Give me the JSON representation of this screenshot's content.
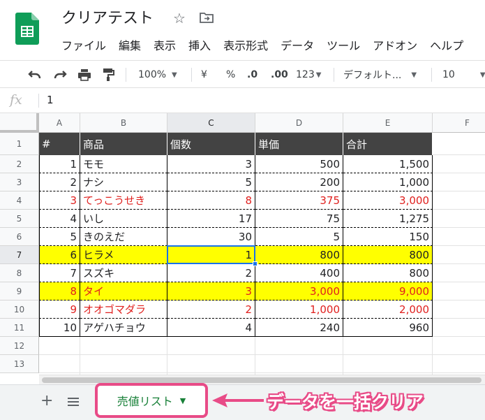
{
  "document": {
    "title": "クリアテスト"
  },
  "menu": [
    "ファイル",
    "編集",
    "表示",
    "挿入",
    "表示形式",
    "データ",
    "ツール",
    "アドオン",
    "ヘルプ"
  ],
  "toolbar": {
    "zoom": "100%",
    "currency": "¥",
    "percent": "%",
    "decrease_decimal": ".0",
    "increase_decimal": ".00",
    "number_format": "123",
    "font": "デフォルト...",
    "font_size": "10"
  },
  "formula_bar": {
    "fx": "fx",
    "value": "1"
  },
  "columns": [
    "A",
    "B",
    "C",
    "D",
    "E",
    "F"
  ],
  "rows": [
    "1",
    "2",
    "3",
    "4",
    "5",
    "6",
    "7",
    "8",
    "9",
    "10",
    "11",
    "12",
    "13"
  ],
  "table": {
    "headers": [
      "#",
      "商品",
      "個数",
      "単価",
      "合計"
    ],
    "data": [
      [
        "1",
        "モモ",
        "3",
        "500",
        "1,500"
      ],
      [
        "2",
        "ナシ",
        "5",
        "200",
        "1,000"
      ],
      [
        "3",
        "てっこうせき",
        "8",
        "375",
        "3,000"
      ],
      [
        "4",
        "いし",
        "17",
        "75",
        "1,275"
      ],
      [
        "5",
        "きのえだ",
        "30",
        "5",
        "150"
      ],
      [
        "6",
        "ヒラメ",
        "1",
        "800",
        "800"
      ],
      [
        "7",
        "スズキ",
        "2",
        "400",
        "800"
      ],
      [
        "8",
        "タイ",
        "3",
        "3,000",
        "9,000"
      ],
      [
        "9",
        "オオゴマダラ",
        "2",
        "1,000",
        "2,000"
      ],
      [
        "10",
        "アゲハチョウ",
        "4",
        "240",
        "960"
      ]
    ],
    "row_styles": [
      "normal",
      "normal",
      "red",
      "normal",
      "normal",
      "yellow",
      "normal",
      "yellow-red",
      "red",
      "normal"
    ]
  },
  "colors": {
    "header_bg": "#434343",
    "highlight_yellow": "#ffff00",
    "text_red": "#e0201e",
    "selection": "#1a73e8",
    "accent_pink": "#e84b87",
    "sheet_green": "#188038"
  },
  "sheet_tab": {
    "label": "売値リスト"
  },
  "annotation": {
    "text": "データを一括クリア"
  }
}
